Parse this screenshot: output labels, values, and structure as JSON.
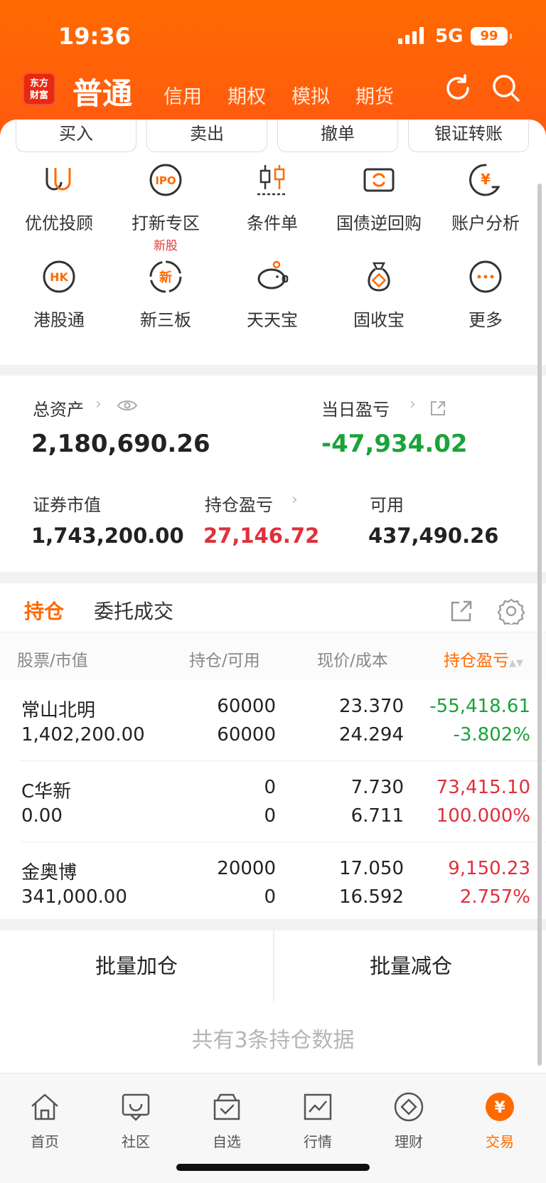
{
  "status": {
    "time": "19:36",
    "network": "5G",
    "battery": "99"
  },
  "nav": {
    "logo_text": "东方财富",
    "tabs": [
      "普通",
      "信用",
      "期权",
      "模拟",
      "期货"
    ],
    "active_tab": "普通"
  },
  "quick_buttons": [
    "买入",
    "卖出",
    "撤单",
    "银证转账"
  ],
  "grid": [
    {
      "label": "优优投顾",
      "icon": "uu-advisor-icon"
    },
    {
      "label": "打新专区",
      "sub": "新股",
      "icon": "ipo-icon"
    },
    {
      "label": "条件单",
      "icon": "candlestick-icon"
    },
    {
      "label": "国债逆回购",
      "icon": "bond-repo-icon"
    },
    {
      "label": "账户分析",
      "icon": "account-analysis-icon"
    },
    {
      "label": "港股通",
      "icon": "hk-icon"
    },
    {
      "label": "新三板",
      "icon": "new-third-board-icon"
    },
    {
      "label": "天天宝",
      "icon": "piggy-bank-icon"
    },
    {
      "label": "固收宝",
      "icon": "money-bag-icon"
    },
    {
      "label": "更多",
      "icon": "more-icon"
    }
  ],
  "assets": {
    "total_label": "总资产",
    "total_value": "2,180,690.26",
    "daily_label": "当日盈亏",
    "daily_value": "-47,934.02",
    "market_label": "证券市值",
    "market_value": "1,743,200.00",
    "pnl_label": "持仓盈亏",
    "pnl_value": "27,146.72",
    "available_label": "可用",
    "available_value": "437,490.26"
  },
  "holdings": {
    "tab_positions": "持仓",
    "tab_orders": "委托成交",
    "headers": {
      "stock": "股票",
      "market_value": "市值",
      "position": "持仓",
      "available": "可用",
      "price": "现价",
      "cost": "成本",
      "pnl": "持仓盈亏"
    },
    "rows": [
      {
        "name": "常山北明",
        "mv": "1,402,200.00",
        "pos": "60000",
        "avail": "60000",
        "price": "23.370",
        "cost": "24.294",
        "pnl": "-55,418.61",
        "pct": "-3.802%",
        "dir": "down"
      },
      {
        "name": "C华新",
        "mv": "0.00",
        "pos": "0",
        "avail": "0",
        "price": "7.730",
        "cost": "6.711",
        "pnl": "73,415.10",
        "pct": "100.000%",
        "dir": "up"
      },
      {
        "name": "金奥博",
        "mv": "341,000.00",
        "pos": "20000",
        "avail": "0",
        "price": "17.050",
        "cost": "16.592",
        "pnl": "9,150.23",
        "pct": "2.757%",
        "dir": "up"
      }
    ],
    "batch_add": "批量加仓",
    "batch_reduce": "批量减仓",
    "total_text": "共有3条持仓数据"
  },
  "tabbar": [
    {
      "label": "首页",
      "icon": "home-icon"
    },
    {
      "label": "社区",
      "icon": "community-icon"
    },
    {
      "label": "自选",
      "icon": "watchlist-icon"
    },
    {
      "label": "行情",
      "icon": "market-icon"
    },
    {
      "label": "理财",
      "icon": "wealth-icon"
    },
    {
      "label": "交易",
      "icon": "trade-icon"
    }
  ],
  "colors": {
    "brand": "#ff6a00",
    "up": "#e0303c",
    "down": "#1aa33a"
  }
}
